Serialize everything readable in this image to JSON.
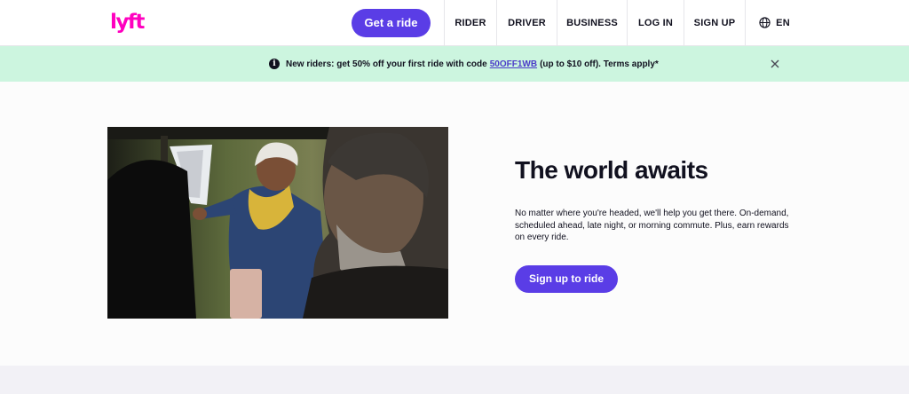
{
  "header": {
    "logo_text": "lyft",
    "get_ride_label": "Get a ride",
    "nav": [
      {
        "label": "RIDER"
      },
      {
        "label": "DRIVER"
      },
      {
        "label": "BUSINESS"
      },
      {
        "label": "LOG IN"
      },
      {
        "label": "SIGN UP"
      },
      {
        "label": "EN",
        "icon": "globe-icon"
      }
    ]
  },
  "banner": {
    "icon": "info-icon",
    "text_before": "New riders: get 50% off your first ride with code",
    "code": "50OFF1WB",
    "text_after": "(up to $10 off). Terms apply*",
    "close_icon": "close-icon"
  },
  "hero": {
    "title": "The world awaits",
    "description": "No matter where you're headed, we'll help you get there. On-demand, scheduled ahead, late night, or morning commute. Plus, earn rewards on every ride.",
    "cta_label": "Sign up to ride"
  },
  "colors": {
    "brand_pink": "#ff00bf",
    "accent_purple": "#5a3de6",
    "banner_green": "#ccf5df",
    "text_dark": "#11111f"
  }
}
